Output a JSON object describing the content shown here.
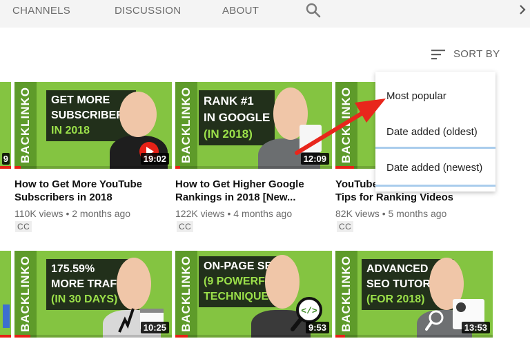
{
  "tabs": [
    {
      "label": "CHANNELS"
    },
    {
      "label": "DISCUSSION"
    },
    {
      "label": "ABOUT"
    }
  ],
  "sort": {
    "label": "SORT BY"
  },
  "menu": {
    "items": [
      {
        "label": "Most popular"
      },
      {
        "label": "Date added (oldest)"
      },
      {
        "label": "Date added (newest)"
      }
    ]
  },
  "brand_text": "BACKLINKO",
  "videos": [
    {
      "headline": [
        "GET MORE",
        "SUBSCRIBERS",
        "IN 2018"
      ],
      "title_line1": "How to Get More YouTube",
      "title_line2": "Subscribers in 2018",
      "meta": "110K views • 2 months ago",
      "cc": "CC",
      "duration": "19:02"
    },
    {
      "headline": [
        "RANK #1",
        "IN GOOGLE",
        "(IN 2018)"
      ],
      "title_line1": "How to Get Higher Google",
      "title_line2": "Rankings in 2018 [New...",
      "meta": "122K views • 4 months ago",
      "cc": "CC",
      "duration": "12:09"
    },
    {
      "headline": [],
      "title_line1": "YouTube SEO: 7 Actionable",
      "title_line2": "Tips for Ranking Videos...",
      "meta": "82K views • 5 months ago",
      "cc": "CC",
      "duration": ""
    },
    {
      "headline": [
        "175.59%",
        "MORE TRAFFIC",
        "(IN 30 DAYS)"
      ],
      "duration": "10:25"
    },
    {
      "headline": [
        "ON-PAGE SEO",
        "(9 POWERFUL",
        "TECHNIQUES)"
      ],
      "duration": "9:53"
    },
    {
      "headline": [
        "ADVANCED",
        "SEO TUTORIAL",
        "(FOR 2018)"
      ],
      "duration": "13:53"
    }
  ],
  "edge_durations": [
    "9"
  ],
  "colors": {
    "thumb_green": "#84c441",
    "headline_bg": "#22301b",
    "accent_green": "#9be04a",
    "arrow_red": "#e8261c",
    "progress_red": "#e62117"
  }
}
